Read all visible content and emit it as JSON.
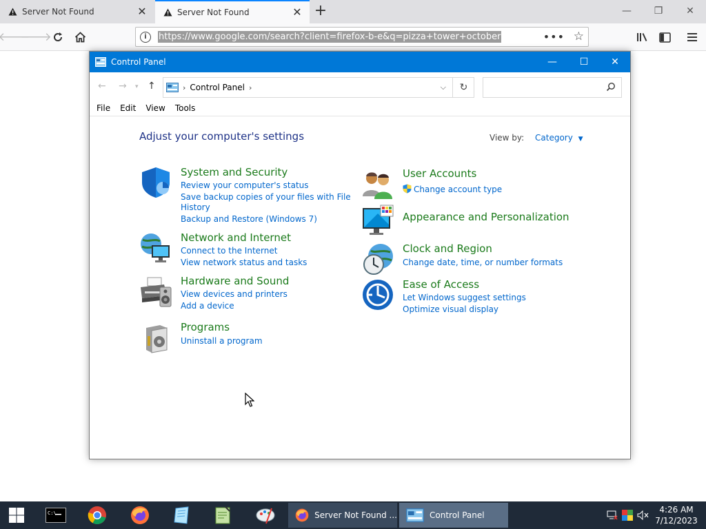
{
  "browser": {
    "tabs": [
      {
        "title": "Server Not Found",
        "active": false
      },
      {
        "title": "Server Not Found",
        "active": true
      }
    ],
    "url": "https://www.google.com/search?client=firefox-b-e&q=pizza+tower+october"
  },
  "control_panel": {
    "window_title": "Control Panel",
    "breadcrumb": "Control Panel",
    "search_placeholder": "",
    "menu": [
      "File",
      "Edit",
      "View",
      "Tools"
    ],
    "heading": "Adjust your computer's settings",
    "view_by_label": "View by:",
    "view_by_value": "Category",
    "categories": [
      {
        "title": "System and Security",
        "icon": "shield-icon",
        "links": [
          "Review your computer's status",
          "Save backup copies of your files with File",
          "History",
          "Backup and Restore (Windows 7)"
        ]
      },
      {
        "title": "Network and Internet",
        "icon": "network-icon",
        "links": [
          "Connect to the Internet",
          "View network status and tasks"
        ]
      },
      {
        "title": "Hardware and Sound",
        "icon": "printer-icon",
        "links": [
          "View devices and printers",
          "Add a device"
        ]
      },
      {
        "title": "Programs",
        "icon": "programs-icon",
        "links": [
          "Uninstall a program"
        ]
      },
      {
        "title": "User Accounts",
        "icon": "users-icon",
        "links": [
          "Change account type"
        ]
      },
      {
        "title": "Appearance and Personalization",
        "icon": "monitor-icon",
        "links": []
      },
      {
        "title": "Clock and Region",
        "icon": "clock-icon",
        "links": [
          "Change date, time, or number formats"
        ]
      },
      {
        "title": "Ease of Access",
        "icon": "ease-access-icon",
        "links": [
          "Let Windows suggest settings",
          "Optimize visual display"
        ]
      }
    ]
  },
  "taskbar": {
    "tasks": [
      "Server Not Found ...",
      "Control Panel"
    ],
    "time": "4:26 AM",
    "date": "7/12/2023"
  },
  "colors": {
    "accent": "#0078d7",
    "category_title": "#1a7a1a",
    "link": "#0066cc",
    "taskbar": "#1f2a38"
  }
}
